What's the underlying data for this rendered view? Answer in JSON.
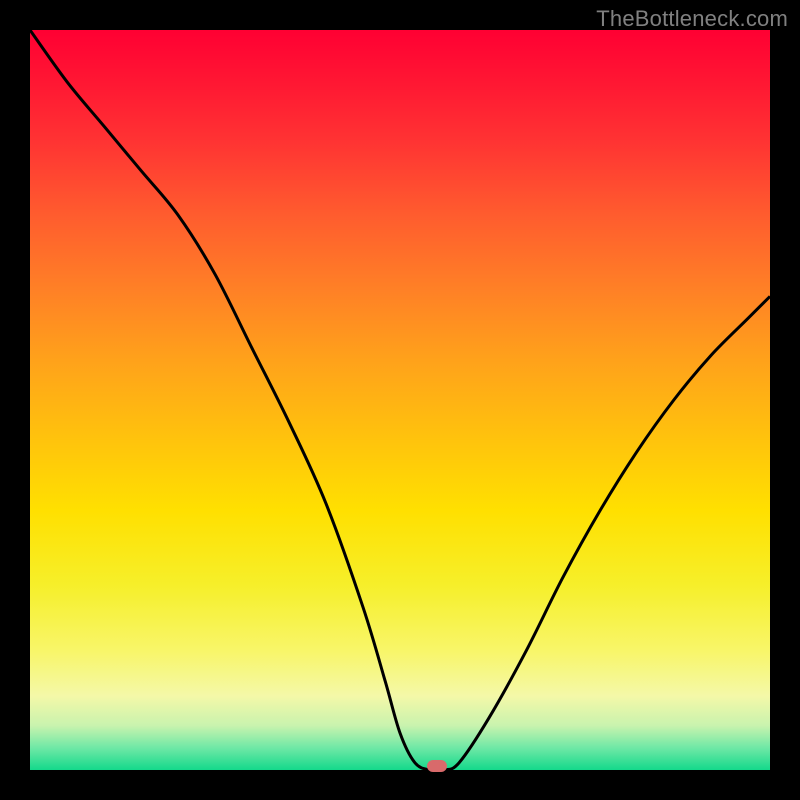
{
  "watermark": "TheBottleneck.com",
  "colors": {
    "marker": "#d86a6b",
    "curve": "#000000"
  },
  "chart_data": {
    "type": "line",
    "title": "",
    "xlabel": "",
    "ylabel": "",
    "xlim": [
      0,
      100
    ],
    "ylim": [
      0,
      100
    ],
    "grid": false,
    "legend": false,
    "series": [
      {
        "name": "bottleneck-curve",
        "x": [
          0,
          5,
          10,
          15,
          20,
          25,
          30,
          35,
          40,
          45,
          48,
          50,
          52,
          54,
          56,
          58,
          62,
          67,
          72,
          77,
          82,
          87,
          92,
          97,
          100
        ],
        "values": [
          100,
          93,
          87,
          81,
          75,
          67,
          57,
          47,
          36,
          22,
          12,
          5,
          1,
          0,
          0,
          1,
          7,
          16,
          26,
          35,
          43,
          50,
          56,
          61,
          64
        ]
      }
    ],
    "minimum_point": {
      "x": 55,
      "y": 0
    }
  }
}
